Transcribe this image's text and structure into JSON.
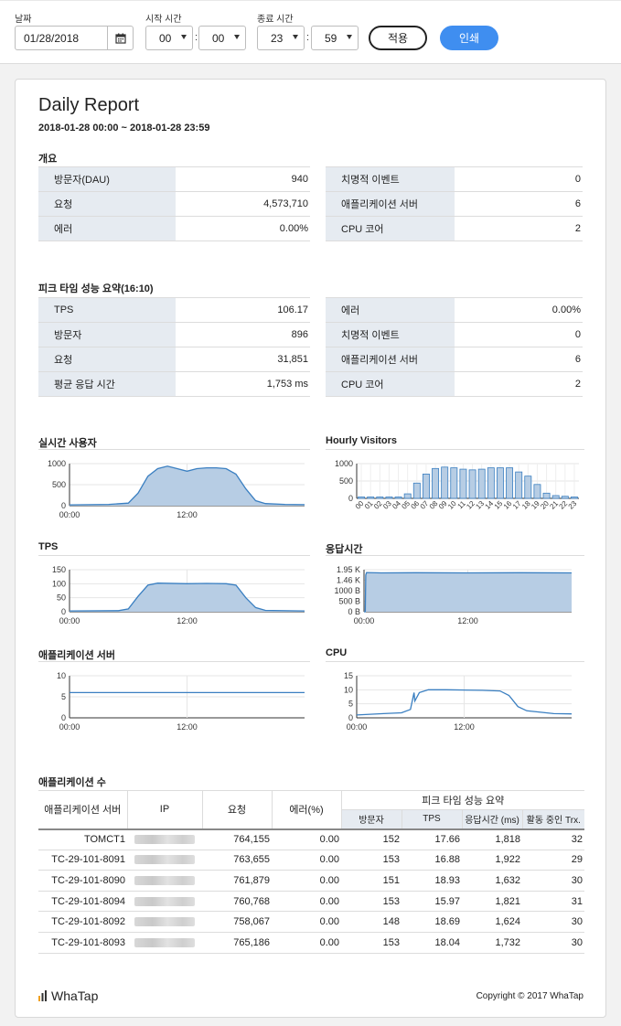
{
  "controls": {
    "date_label": "날짜",
    "date_value": "01/28/2018",
    "start_label": "시작 시간",
    "start_hour": "00",
    "start_min": "00",
    "end_label": "종료 시간",
    "end_hour": "23",
    "end_min": "59",
    "colon": ":",
    "apply_label": "적용",
    "print_label": "인쇄"
  },
  "report": {
    "title": "Daily Report",
    "range": "2018-01-28 00:00 ~ 2018-01-28 23:59"
  },
  "overview": {
    "title": "개요",
    "left": [
      {
        "k": "방문자(DAU)",
        "v": "940"
      },
      {
        "k": "요청",
        "v": "4,573,710"
      },
      {
        "k": "에러",
        "v": "0.00%"
      }
    ],
    "right": [
      {
        "k": "치명적 이벤트",
        "v": "0"
      },
      {
        "k": "애플리케이션 서버",
        "v": "6"
      },
      {
        "k": "CPU 코어",
        "v": "2"
      }
    ]
  },
  "peak": {
    "title": "피크 타임 성능 요약(16:10)",
    "left": [
      {
        "k": "TPS",
        "v": "106.17"
      },
      {
        "k": "방문자",
        "v": "896"
      },
      {
        "k": "요청",
        "v": "31,851"
      },
      {
        "k": "평균 응답 시간",
        "v": "1,753 ms"
      }
    ],
    "right": [
      {
        "k": "에러",
        "v": "0.00%"
      },
      {
        "k": "치명적 이벤트",
        "v": "0"
      },
      {
        "k": "애플리케이션 서버",
        "v": "6"
      },
      {
        "k": "CPU 코어",
        "v": "2"
      }
    ]
  },
  "chart_data": [
    {
      "type": "area",
      "title": "실시간 사용자",
      "yticks": [
        "1000",
        "500",
        "0"
      ],
      "ylim": [
        0,
        1000
      ],
      "xticks": [
        "00:00",
        "12:00"
      ],
      "points": [
        [
          0,
          20
        ],
        [
          4,
          30
        ],
        [
          6,
          60
        ],
        [
          7,
          300
        ],
        [
          8,
          700
        ],
        [
          9,
          880
        ],
        [
          10,
          940
        ],
        [
          11,
          880
        ],
        [
          12,
          820
        ],
        [
          13,
          880
        ],
        [
          14,
          900
        ],
        [
          15,
          900
        ],
        [
          16,
          880
        ],
        [
          17,
          750
        ],
        [
          18,
          400
        ],
        [
          19,
          120
        ],
        [
          20,
          50
        ],
        [
          22,
          30
        ],
        [
          24,
          25
        ]
      ],
      "color": "#3a7fc1"
    },
    {
      "type": "bar",
      "title": "Hourly Visitors",
      "yticks": [
        "1000",
        "500",
        "0"
      ],
      "ylim": [
        0,
        1000
      ],
      "categories": [
        "00",
        "01",
        "02",
        "03",
        "04",
        "05",
        "06",
        "07",
        "08",
        "09",
        "10",
        "11",
        "12",
        "13",
        "14",
        "15",
        "16",
        "17",
        "18",
        "19",
        "20",
        "21",
        "22",
        "23"
      ],
      "values": [
        40,
        40,
        40,
        40,
        40,
        130,
        440,
        700,
        860,
        900,
        880,
        840,
        820,
        840,
        880,
        880,
        880,
        760,
        640,
        400,
        150,
        80,
        60,
        40
      ],
      "color": "#3a7fc1"
    },
    {
      "type": "area",
      "title": "TPS",
      "yticks": [
        "150",
        "100",
        "50",
        "0"
      ],
      "ylim": [
        0,
        150
      ],
      "xticks": [
        "00:00",
        "12:00"
      ],
      "points": [
        [
          0,
          3
        ],
        [
          5,
          4
        ],
        [
          6,
          10
        ],
        [
          7,
          55
        ],
        [
          8,
          95
        ],
        [
          9,
          102
        ],
        [
          12,
          100
        ],
        [
          14,
          101
        ],
        [
          16,
          100
        ],
        [
          17,
          95
        ],
        [
          18,
          50
        ],
        [
          19,
          15
        ],
        [
          20,
          5
        ],
        [
          24,
          3
        ]
      ],
      "color": "#3a7fc1"
    },
    {
      "type": "area",
      "title": "응답시간",
      "yticks": [
        "1.95 K",
        "1.46 K",
        "1000 B",
        "500 B",
        "0 B"
      ],
      "ylim": [
        0,
        1950
      ],
      "xticks": [
        "00:00",
        "12:00"
      ],
      "points": [
        [
          0,
          0
        ],
        [
          0.15,
          0
        ],
        [
          0.2,
          1700
        ],
        [
          0.3,
          1820
        ],
        [
          2,
          1800
        ],
        [
          6,
          1810
        ],
        [
          12,
          1800
        ],
        [
          18,
          1810
        ],
        [
          24,
          1800
        ]
      ],
      "color": "#3a7fc1"
    },
    {
      "type": "line",
      "title": "애플리케이션 서버",
      "yticks": [
        "10",
        "5",
        "0"
      ],
      "ylim": [
        0,
        10
      ],
      "xticks": [
        "00:00",
        "12:00"
      ],
      "points": [
        [
          0,
          6
        ],
        [
          24,
          6
        ]
      ],
      "color": "#3a7fc1"
    },
    {
      "type": "line",
      "title": "CPU",
      "yticks": [
        "15",
        "10",
        "5",
        "0"
      ],
      "ylim": [
        0,
        15
      ],
      "xticks": [
        "00:00",
        "12:00"
      ],
      "points": [
        [
          0,
          1
        ],
        [
          3,
          1.5
        ],
        [
          5,
          1.8
        ],
        [
          6,
          3
        ],
        [
          6.4,
          9
        ],
        [
          6.5,
          6
        ],
        [
          7,
          9
        ],
        [
          8,
          10
        ],
        [
          10,
          10
        ],
        [
          14,
          9.8
        ],
        [
          16,
          9.6
        ],
        [
          17,
          8
        ],
        [
          18,
          4
        ],
        [
          19,
          2.5
        ],
        [
          22,
          1.5
        ],
        [
          24,
          1.4
        ]
      ],
      "color": "#3a7fc1"
    }
  ],
  "apps": {
    "title": "애플리케이션 수",
    "headers": {
      "server": "애플리케이션 서버",
      "ip": "IP",
      "req": "요청",
      "err": "에러(%)",
      "peak": "피크 타임 성능 요약",
      "visitors": "방문자",
      "tps": "TPS",
      "resp": "응답시간 (ms)",
      "trx": "활동 중인 Trx."
    },
    "rows": [
      {
        "server": "TOMCT1",
        "req": "764,155",
        "err": "0.00",
        "visitors": "152",
        "tps": "17.66",
        "resp": "1,818",
        "trx": "32"
      },
      {
        "server": "TC-29-101-8091",
        "req": "763,655",
        "err": "0.00",
        "visitors": "153",
        "tps": "16.88",
        "resp": "1,922",
        "trx": "29"
      },
      {
        "server": "TC-29-101-8090",
        "req": "761,879",
        "err": "0.00",
        "visitors": "151",
        "tps": "18.93",
        "resp": "1,632",
        "trx": "30"
      },
      {
        "server": "TC-29-101-8094",
        "req": "760,768",
        "err": "0.00",
        "visitors": "153",
        "tps": "15.97",
        "resp": "1,821",
        "trx": "31"
      },
      {
        "server": "TC-29-101-8092",
        "req": "758,067",
        "err": "0.00",
        "visitors": "148",
        "tps": "18.69",
        "resp": "1,624",
        "trx": "30"
      },
      {
        "server": "TC-29-101-8093",
        "req": "765,186",
        "err": "0.00",
        "visitors": "153",
        "tps": "18.04",
        "resp": "1,732",
        "trx": "30"
      }
    ]
  },
  "footer": {
    "logo": "WhaTap",
    "copyright": "Copyright © 2017 WhaTap"
  }
}
